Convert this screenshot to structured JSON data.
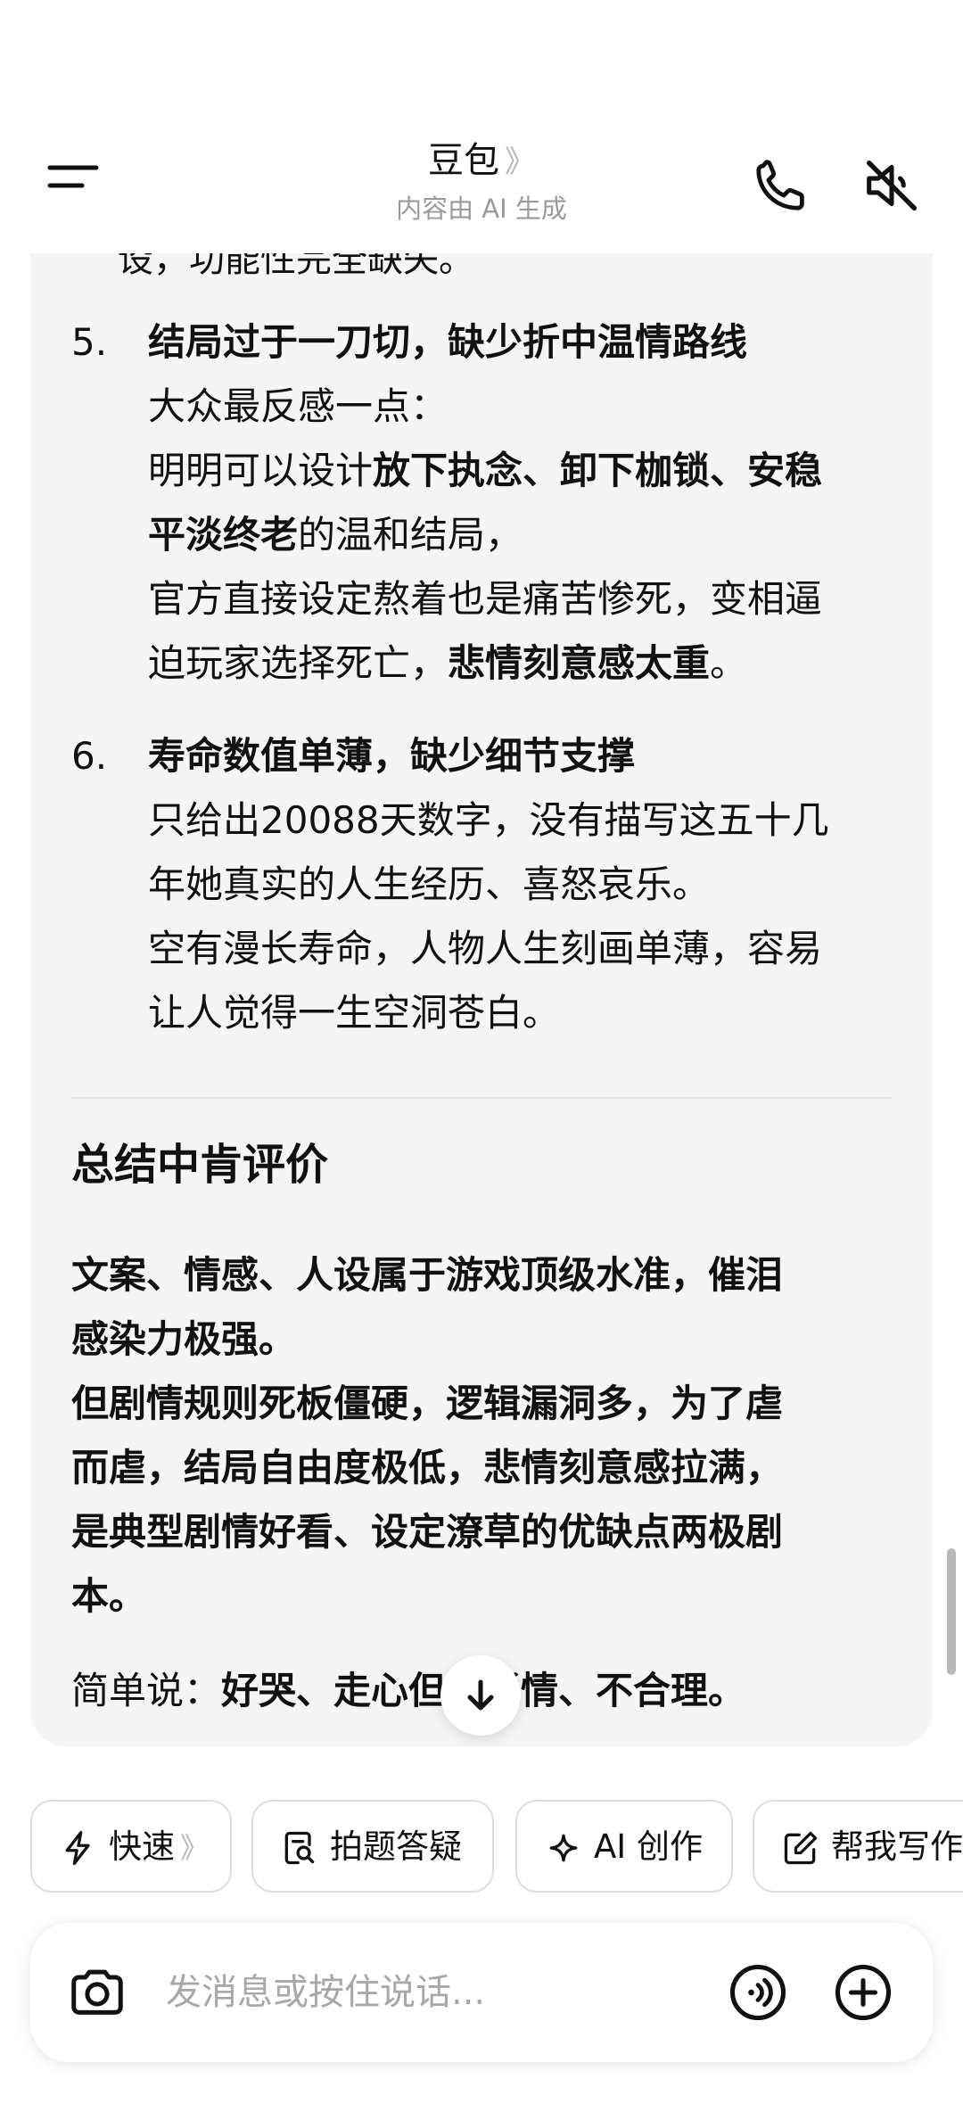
{
  "header": {
    "title": "豆包",
    "title_chevron": "》",
    "subtitle": "内容由 AI 生成",
    "icons": [
      "menu-icon",
      "phone-icon",
      "speaker-muted-icon"
    ]
  },
  "message": {
    "cut_line": "设，功能性完全缺失。",
    "items": [
      {
        "number": "5.",
        "title": "结局过于一刀切，缺少折中温情路线",
        "lines": [
          [
            {
              "t": "大众最反感一点："
            }
          ],
          [
            {
              "t": "明明可以设计"
            },
            {
              "t": "放下执念、卸下枷锁、安稳",
              "b": true
            }
          ],
          [
            {
              "t": "平淡终老",
              "b": true
            },
            {
              "t": "的温和结局，"
            }
          ],
          [
            {
              "t": "官方直接设定熬着也是痛苦惨死，变相逼"
            }
          ],
          [
            {
              "t": "迫玩家选择死亡，"
            },
            {
              "t": "悲情刻意感太重",
              "b": true
            },
            {
              "t": "。"
            }
          ]
        ]
      },
      {
        "number": "6.",
        "title": "寿命数值单薄，缺少细节支撑",
        "lines": [
          [
            {
              "t": "只给出20088天数字，没有描写这五十几"
            }
          ],
          [
            {
              "t": "年她真实的人生经历、喜怒哀乐。"
            }
          ],
          [
            {
              "t": "空有漫长寿命，人物人生刻画单薄，容易"
            }
          ],
          [
            {
              "t": "让人觉得一生空洞苍白。"
            }
          ]
        ]
      }
    ],
    "summary_heading": "总结中肯评价",
    "summary_lines": [
      "文案、情感、人设属于游戏顶级水准，催泪",
      "感染力极强。",
      "但剧情规则死板僵硬，逻辑漏洞多，为了虐",
      "而虐，结局自由度极低，悲情刻意感拉满，",
      "是典型剧情好看、设定潦草的优缺点两极剧",
      "本。"
    ],
    "simple_prefix": "简单说：",
    "simple_bold_1": "好哭、走心",
    "simple_bold_2": "但不通情、不合理。"
  },
  "quick_actions": [
    {
      "label": "快速",
      "icon": "lightning-icon",
      "chevron": "》"
    },
    {
      "label": "拍题答疑",
      "icon": "photo-search-icon"
    },
    {
      "label": "AI 创作",
      "icon": "sparkle-icon"
    },
    {
      "label": "帮我写作",
      "icon": "edit-icon"
    }
  ],
  "input": {
    "placeholder": "发消息或按住说话..."
  },
  "colors": {
    "card_background": "#f5f5f6",
    "secondary_text": "#9a9a9a",
    "placeholder_text": "#a8a8a8"
  }
}
